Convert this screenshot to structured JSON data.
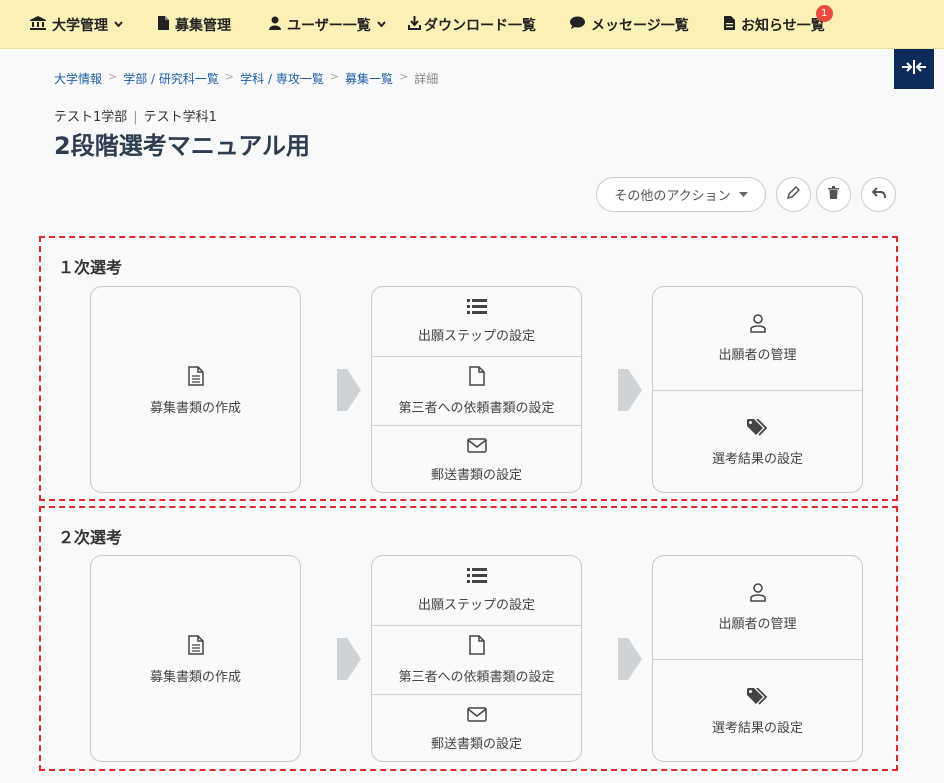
{
  "nav": {
    "univ": "大学管理",
    "recruit": "募集管理",
    "users": "ユーザー一覧",
    "downloads": "ダウンロード一覧",
    "messages": "メッセージ一覧",
    "notices": "お知らせ一覧",
    "notice_badge": "1"
  },
  "breadcrumb": {
    "items": [
      "大学情報",
      "学部 / 研究科一覧",
      "学科 / 専攻一覧",
      "募集一覧"
    ],
    "current": "詳細"
  },
  "subtitle": {
    "faculty": "テスト1学部",
    "department": "テスト学科1"
  },
  "page_title": "2段階選考マニュアル用",
  "actions": {
    "other": "その他のアクション"
  },
  "stages": [
    {
      "title": "１次選考",
      "create_docs": "募集書類の作成",
      "steps": "出願ステップの設定",
      "third_party": "第三者への依頼書類の設定",
      "mail_docs": "郵送書類の設定",
      "applicants": "出願者の管理",
      "results": "選考結果の設定"
    },
    {
      "title": "２次選考",
      "create_docs": "募集書類の作成",
      "steps": "出願ステップの設定",
      "third_party": "第三者への依頼書類の設定",
      "mail_docs": "郵送書類の設定",
      "applicants": "出願者の管理",
      "results": "選考結果の設定"
    }
  ],
  "colors": {
    "nav_bg": "#fbf1b6",
    "accent": "#0d2c5a",
    "dashed": "#e02b2b",
    "link": "#1e5fa8"
  }
}
